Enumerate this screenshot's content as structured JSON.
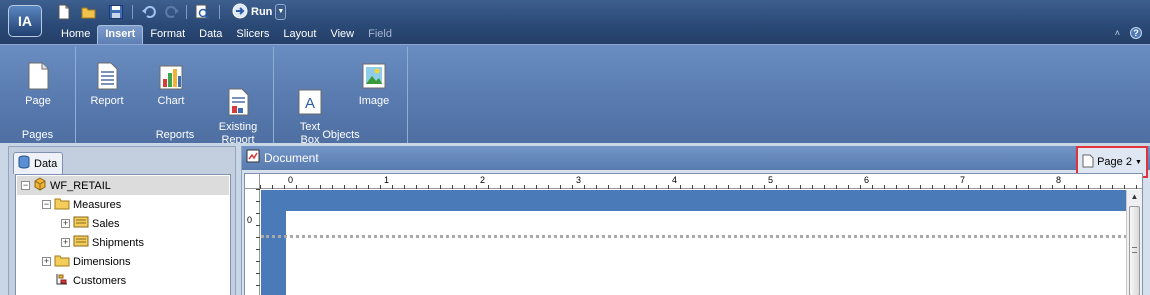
{
  "app": {
    "logo_text": "IA"
  },
  "quick_access": {
    "icons": [
      "new-document-icon",
      "open-folder-icon",
      "save-icon",
      "undo-icon",
      "redo-icon",
      "print-preview-icon"
    ],
    "run_label": "Run"
  },
  "menu": {
    "tabs": [
      {
        "label": "Home",
        "state": "normal"
      },
      {
        "label": "Insert",
        "state": "active"
      },
      {
        "label": "Format",
        "state": "normal"
      },
      {
        "label": "Data",
        "state": "normal"
      },
      {
        "label": "Slicers",
        "state": "normal"
      },
      {
        "label": "Layout",
        "state": "normal"
      },
      {
        "label": "View",
        "state": "normal"
      },
      {
        "label": "Field",
        "state": "disabled"
      }
    ],
    "collapse_glyph": "˄",
    "help_glyph": "?"
  },
  "ribbon": {
    "groups": [
      {
        "title": "Pages",
        "buttons": [
          {
            "label": "Page",
            "icon": "page-icon"
          }
        ]
      },
      {
        "title": "Reports",
        "buttons": [
          {
            "label": "Report",
            "icon": "report-icon"
          },
          {
            "label": "Chart",
            "icon": "chart-icon"
          },
          {
            "label": "Existing\nReport",
            "icon": "existing-report-icon"
          }
        ]
      },
      {
        "title": "Objects",
        "buttons": [
          {
            "label": "Text\nBox",
            "icon": "text-box-icon"
          },
          {
            "label": "Image",
            "icon": "image-icon"
          }
        ]
      }
    ]
  },
  "data_panel": {
    "tab_label": "Data",
    "tree": {
      "root": "WF_RETAIL",
      "measures": "Measures",
      "sales": "Sales",
      "shipments": "Shipments",
      "dimensions": "Dimensions",
      "customers": "Customers"
    }
  },
  "document": {
    "title": "Document",
    "page_selector": "Page 2",
    "ruler_h_labels": [
      "0",
      "1",
      "2",
      "3",
      "4",
      "5",
      "6",
      "7",
      "8"
    ],
    "ruler_v_labels": [
      "0"
    ]
  },
  "colors": {
    "accent": "#2b4a77",
    "ribbon": "#5779ad",
    "page_margin": "#4a7ab8",
    "highlight": "#e2333a"
  }
}
